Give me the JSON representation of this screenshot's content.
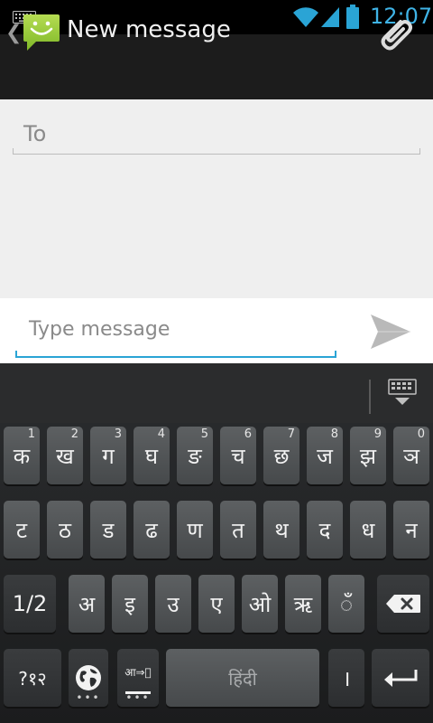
{
  "status_bar": {
    "time": "12:07"
  },
  "action_bar": {
    "title": "New message"
  },
  "recipients": {
    "placeholder": "To"
  },
  "compose": {
    "placeholder": "Type message"
  },
  "keyboard": {
    "row1": [
      {
        "label": "क",
        "hint": "1"
      },
      {
        "label": "ख",
        "hint": "2"
      },
      {
        "label": "ग",
        "hint": "3"
      },
      {
        "label": "घ",
        "hint": "4"
      },
      {
        "label": "ङ",
        "hint": "5"
      },
      {
        "label": "च",
        "hint": "6"
      },
      {
        "label": "छ",
        "hint": "7"
      },
      {
        "label": "ज",
        "hint": "8"
      },
      {
        "label": "झ",
        "hint": "9"
      },
      {
        "label": "ञ",
        "hint": "0"
      }
    ],
    "row2": [
      {
        "label": "ट"
      },
      {
        "label": "ठ"
      },
      {
        "label": "ड"
      },
      {
        "label": "ढ"
      },
      {
        "label": "ण"
      },
      {
        "label": "त"
      },
      {
        "label": "थ"
      },
      {
        "label": "द"
      },
      {
        "label": "ध"
      },
      {
        "label": "न"
      }
    ],
    "row3": {
      "shift_label": "1/2",
      "keys": [
        {
          "label": "अ"
        },
        {
          "label": "इ"
        },
        {
          "label": "उ"
        },
        {
          "label": "ए"
        },
        {
          "label": "ओ"
        },
        {
          "label": "ऋ"
        },
        {
          "label": "ँ"
        }
      ]
    },
    "row4": {
      "symbols_label": "?१२",
      "translit_label": "आ⇒ा",
      "space_label": "हिंदी",
      "danda_label": "।"
    }
  }
}
